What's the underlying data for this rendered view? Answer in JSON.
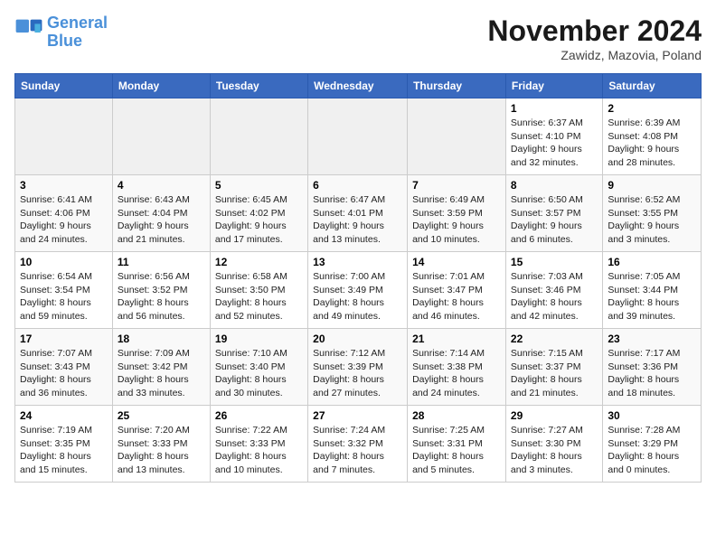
{
  "logo": {
    "line1": "General",
    "line2": "Blue"
  },
  "title": "November 2024",
  "location": "Zawidz, Mazovia, Poland",
  "weekdays": [
    "Sunday",
    "Monday",
    "Tuesday",
    "Wednesday",
    "Thursday",
    "Friday",
    "Saturday"
  ],
  "weeks": [
    [
      {
        "day": "",
        "info": ""
      },
      {
        "day": "",
        "info": ""
      },
      {
        "day": "",
        "info": ""
      },
      {
        "day": "",
        "info": ""
      },
      {
        "day": "",
        "info": ""
      },
      {
        "day": "1",
        "info": "Sunrise: 6:37 AM\nSunset: 4:10 PM\nDaylight: 9 hours and 32 minutes."
      },
      {
        "day": "2",
        "info": "Sunrise: 6:39 AM\nSunset: 4:08 PM\nDaylight: 9 hours and 28 minutes."
      }
    ],
    [
      {
        "day": "3",
        "info": "Sunrise: 6:41 AM\nSunset: 4:06 PM\nDaylight: 9 hours and 24 minutes."
      },
      {
        "day": "4",
        "info": "Sunrise: 6:43 AM\nSunset: 4:04 PM\nDaylight: 9 hours and 21 minutes."
      },
      {
        "day": "5",
        "info": "Sunrise: 6:45 AM\nSunset: 4:02 PM\nDaylight: 9 hours and 17 minutes."
      },
      {
        "day": "6",
        "info": "Sunrise: 6:47 AM\nSunset: 4:01 PM\nDaylight: 9 hours and 13 minutes."
      },
      {
        "day": "7",
        "info": "Sunrise: 6:49 AM\nSunset: 3:59 PM\nDaylight: 9 hours and 10 minutes."
      },
      {
        "day": "8",
        "info": "Sunrise: 6:50 AM\nSunset: 3:57 PM\nDaylight: 9 hours and 6 minutes."
      },
      {
        "day": "9",
        "info": "Sunrise: 6:52 AM\nSunset: 3:55 PM\nDaylight: 9 hours and 3 minutes."
      }
    ],
    [
      {
        "day": "10",
        "info": "Sunrise: 6:54 AM\nSunset: 3:54 PM\nDaylight: 8 hours and 59 minutes."
      },
      {
        "day": "11",
        "info": "Sunrise: 6:56 AM\nSunset: 3:52 PM\nDaylight: 8 hours and 56 minutes."
      },
      {
        "day": "12",
        "info": "Sunrise: 6:58 AM\nSunset: 3:50 PM\nDaylight: 8 hours and 52 minutes."
      },
      {
        "day": "13",
        "info": "Sunrise: 7:00 AM\nSunset: 3:49 PM\nDaylight: 8 hours and 49 minutes."
      },
      {
        "day": "14",
        "info": "Sunrise: 7:01 AM\nSunset: 3:47 PM\nDaylight: 8 hours and 46 minutes."
      },
      {
        "day": "15",
        "info": "Sunrise: 7:03 AM\nSunset: 3:46 PM\nDaylight: 8 hours and 42 minutes."
      },
      {
        "day": "16",
        "info": "Sunrise: 7:05 AM\nSunset: 3:44 PM\nDaylight: 8 hours and 39 minutes."
      }
    ],
    [
      {
        "day": "17",
        "info": "Sunrise: 7:07 AM\nSunset: 3:43 PM\nDaylight: 8 hours and 36 minutes."
      },
      {
        "day": "18",
        "info": "Sunrise: 7:09 AM\nSunset: 3:42 PM\nDaylight: 8 hours and 33 minutes."
      },
      {
        "day": "19",
        "info": "Sunrise: 7:10 AM\nSunset: 3:40 PM\nDaylight: 8 hours and 30 minutes."
      },
      {
        "day": "20",
        "info": "Sunrise: 7:12 AM\nSunset: 3:39 PM\nDaylight: 8 hours and 27 minutes."
      },
      {
        "day": "21",
        "info": "Sunrise: 7:14 AM\nSunset: 3:38 PM\nDaylight: 8 hours and 24 minutes."
      },
      {
        "day": "22",
        "info": "Sunrise: 7:15 AM\nSunset: 3:37 PM\nDaylight: 8 hours and 21 minutes."
      },
      {
        "day": "23",
        "info": "Sunrise: 7:17 AM\nSunset: 3:36 PM\nDaylight: 8 hours and 18 minutes."
      }
    ],
    [
      {
        "day": "24",
        "info": "Sunrise: 7:19 AM\nSunset: 3:35 PM\nDaylight: 8 hours and 15 minutes."
      },
      {
        "day": "25",
        "info": "Sunrise: 7:20 AM\nSunset: 3:33 PM\nDaylight: 8 hours and 13 minutes."
      },
      {
        "day": "26",
        "info": "Sunrise: 7:22 AM\nSunset: 3:33 PM\nDaylight: 8 hours and 10 minutes."
      },
      {
        "day": "27",
        "info": "Sunrise: 7:24 AM\nSunset: 3:32 PM\nDaylight: 8 hours and 7 minutes."
      },
      {
        "day": "28",
        "info": "Sunrise: 7:25 AM\nSunset: 3:31 PM\nDaylight: 8 hours and 5 minutes."
      },
      {
        "day": "29",
        "info": "Sunrise: 7:27 AM\nSunset: 3:30 PM\nDaylight: 8 hours and 3 minutes."
      },
      {
        "day": "30",
        "info": "Sunrise: 7:28 AM\nSunset: 3:29 PM\nDaylight: 8 hours and 0 minutes."
      }
    ]
  ]
}
